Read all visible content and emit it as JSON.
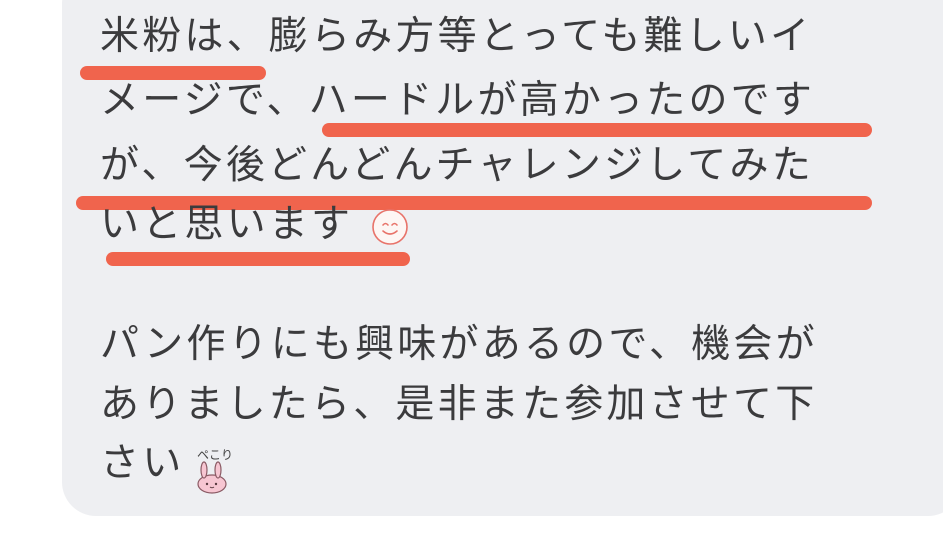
{
  "message": {
    "paragraph1_lines": [
      "米粉は、膨らみ方等とっても難しいイ",
      "メージで、ハードルが高かったのです",
      "が、今後どんどんチャレンジしてみた",
      "いと思います"
    ],
    "paragraph2_lines": [
      "パン作りにも興味があるので、機会が",
      "ありましたら、是非また参加させて下",
      "さい"
    ],
    "sticker_text": "ペこり",
    "emoji_icons": [
      "smiley-face-icon",
      "bowing-rabbit-sticker"
    ]
  },
  "colors": {
    "bubble_bg": "#eeeff2",
    "text": "#3b3b3d",
    "highlight": "#f0583f"
  }
}
